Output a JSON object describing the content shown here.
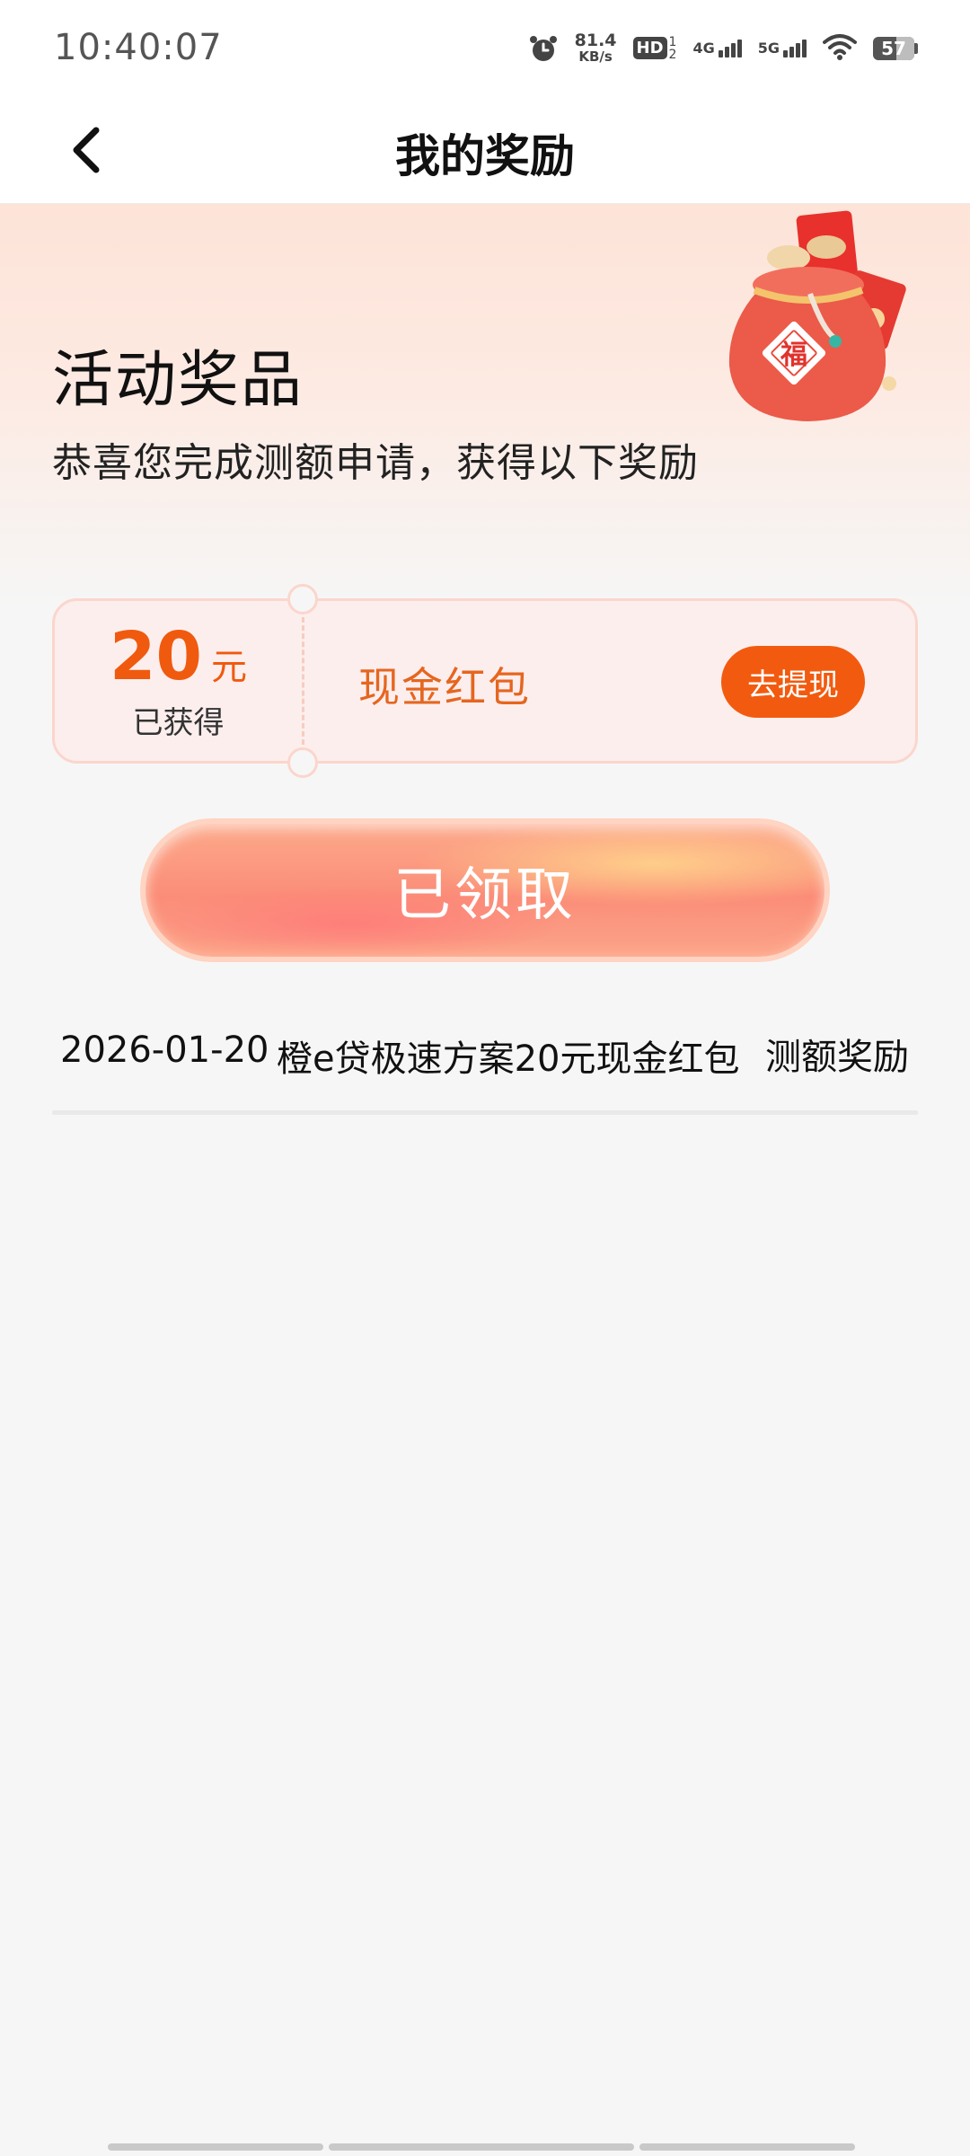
{
  "status_bar": {
    "time": "10:40:07",
    "net_speed_value": "81.4",
    "net_speed_unit": "KB/s",
    "hd_label": "HD",
    "hd_sub_top": "1",
    "hd_sub_bottom": "2",
    "sim1_label": "4G",
    "sim2_label": "5G",
    "battery_level": "57",
    "battery_fraction": 0.57
  },
  "header": {
    "title": "我的奖励",
    "back_icon": "chevron-left-icon"
  },
  "hero": {
    "title": "活动奖品",
    "subtitle": "恭喜您完成测额申请，获得以下奖励",
    "bag_text": "福"
  },
  "reward_card": {
    "amount": "20",
    "unit": "元",
    "status": "已获得",
    "name": "现金红包",
    "action_label": "去提现"
  },
  "claim_button": {
    "label": "已领取"
  },
  "records": [
    {
      "date": "2026-01-20",
      "description": "橙e贷极速方案20元现金红包",
      "type": "测额奖励"
    }
  ],
  "colors": {
    "accent": "#f25b0f",
    "amount_text": "#f05a0e",
    "reward_name_text": "#e5661f",
    "card_bg": "#fdeeee",
    "page_bg": "#f6f6f6"
  }
}
